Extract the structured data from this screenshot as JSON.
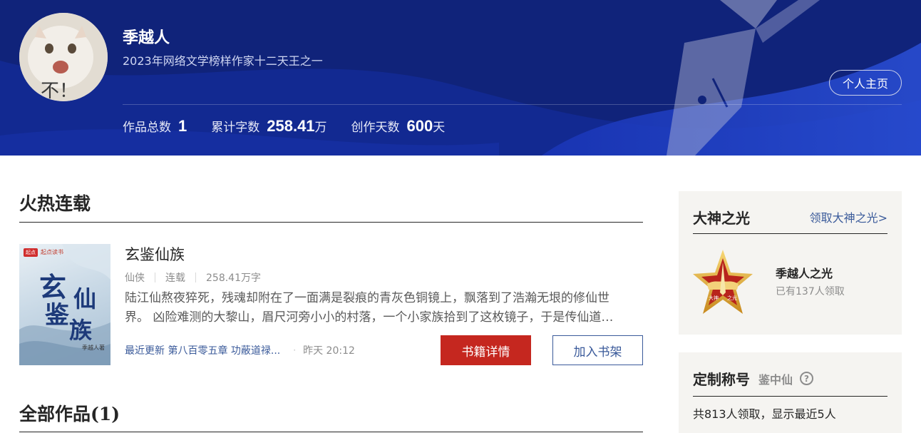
{
  "header": {
    "author_name": "季越人",
    "author_title": "2023年网络文学榜样作家十二天王之一",
    "home_button": "个人主页",
    "avatar_caption": "不！",
    "stats": [
      {
        "label": "作品总数",
        "value": "1",
        "unit": ""
      },
      {
        "label": "累计字数",
        "value": "258.41",
        "unit": "万"
      },
      {
        "label": "创作天数",
        "value": "600",
        "unit": "天"
      }
    ]
  },
  "hot": {
    "section_title": "火热连载",
    "book": {
      "title": "玄鉴仙族",
      "genre": "仙侠",
      "status": "连载",
      "word_count": "258.41万字",
      "description": "陆江仙熬夜猝死，残魂却附在了一面满是裂痕的青灰色铜镜上，飘落到了浩瀚无垠的修仙世界。 凶险难测的大黎山，眉尺河旁小小的村落，一个小家族拾到了这枚镜子，于是传仙道…",
      "latest_update": "最近更新 第八百零五章 功蔽道禄...",
      "update_time": "昨天 20:12",
      "cover": {
        "badge": "起点",
        "badge_text": "起点读书",
        "title_chars": [
          "玄",
          "鉴",
          "仙",
          "族"
        ],
        "author": "季越人著"
      }
    },
    "detail_button": "书籍详情",
    "shelf_button": "加入书架"
  },
  "all_works": {
    "section_title": "全部作品(1)"
  },
  "sidebar": {
    "glory": {
      "title": "大神之光",
      "link": "领取大神之光>",
      "medal_name": "季越人之光",
      "medal_count": "已有137人领取",
      "medal_text_left": "大神",
      "medal_text_right": "之光"
    },
    "custom": {
      "title": "定制称号",
      "tag": "鉴中仙",
      "help": "?",
      "subtitle": "共813人领取，显示最近5人"
    }
  },
  "colors": {
    "banner": "#10237a",
    "accent_red": "#c5271f",
    "link_blue": "#3a5a9a",
    "sidebar_bg": "#f5f4f1"
  }
}
